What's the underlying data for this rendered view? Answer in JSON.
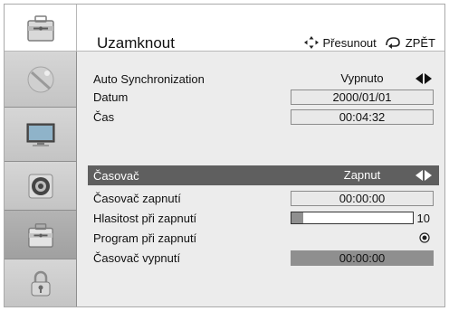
{
  "header": {
    "title": "Uzamknout",
    "move_label": "Přesunout",
    "back_label": "ZPĚT"
  },
  "tabs": [
    {
      "icon": "toolbox-icon"
    },
    {
      "icon": "satellite-dish-icon"
    },
    {
      "icon": "monitor-icon"
    },
    {
      "icon": "speaker-icon"
    },
    {
      "icon": "toolbox-icon"
    },
    {
      "icon": "padlock-icon"
    }
  ],
  "settings": {
    "auto_sync": {
      "label": "Auto Synchronization",
      "value": "Vypnuto"
    },
    "datum": {
      "label": "Datum",
      "value": "2000/01/01"
    },
    "cas": {
      "label": "Čas",
      "value": "00:04:32"
    },
    "casovac": {
      "label": "Časovač",
      "value": "Zapnut"
    },
    "casovac_zapnuti": {
      "label": "Časovač zapnutí",
      "value": "00:00:00"
    },
    "hlasitost": {
      "label": "Hlasitost při zapnutí",
      "value": "10",
      "level": 0.1
    },
    "program": {
      "label": "Program při zapnutí"
    },
    "casovac_vypnuti": {
      "label": "Časovač vypnutí",
      "value": "00:00:00"
    }
  },
  "colors": {
    "selected_bg": "#5f5f5f",
    "content_bg": "#ececec",
    "active_tab_bg": "#a8a8a8"
  }
}
